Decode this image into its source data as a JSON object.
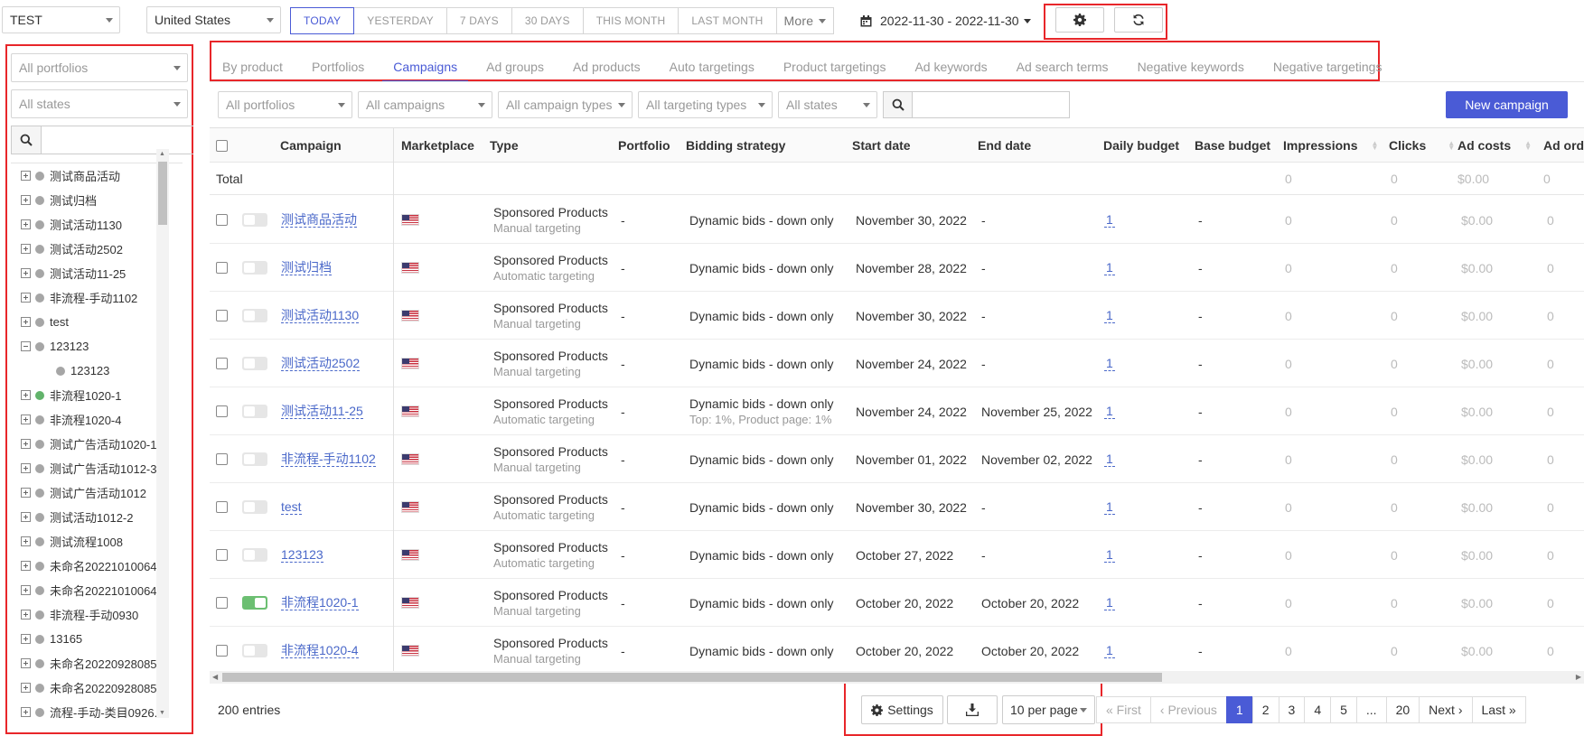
{
  "account_select": "TEST",
  "country_select": "United States",
  "date_buttons": [
    "TODAY",
    "YESTERDAY",
    "7 DAYS",
    "30 DAYS",
    "THIS MONTH",
    "LAST MONTH"
  ],
  "more_label": "More",
  "date_range": "2022-11-30 - 2022-11-30",
  "sidebar": {
    "portfolio_filter": "All portfolios",
    "state_filter": "All states",
    "tree": [
      {
        "label": "测试商品活动",
        "icon": "plus",
        "dot": "gray"
      },
      {
        "label": "测试归档",
        "icon": "plus",
        "dot": "gray"
      },
      {
        "label": "测试活动1130",
        "icon": "plus",
        "dot": "gray"
      },
      {
        "label": "测试活动2502",
        "icon": "plus",
        "dot": "gray"
      },
      {
        "label": "测试活动11-25",
        "icon": "plus",
        "dot": "gray"
      },
      {
        "label": "非流程-手动1102",
        "icon": "plus",
        "dot": "gray"
      },
      {
        "label": "test",
        "icon": "plus",
        "dot": "gray"
      },
      {
        "label": "123123",
        "icon": "minus",
        "dot": "gray"
      },
      {
        "label": "123123",
        "icon": "child",
        "dot": "gray"
      },
      {
        "label": "非流程1020-1",
        "icon": "plus",
        "dot": "green"
      },
      {
        "label": "非流程1020-4",
        "icon": "plus",
        "dot": "gray"
      },
      {
        "label": "测试广告活动1020-1",
        "icon": "plus",
        "dot": "gray"
      },
      {
        "label": "测试广告活动1012-3",
        "icon": "plus",
        "dot": "gray"
      },
      {
        "label": "测试广告活动1012",
        "icon": "plus",
        "dot": "gray"
      },
      {
        "label": "测试活动1012-2",
        "icon": "plus",
        "dot": "gray"
      },
      {
        "label": "测试流程1008",
        "icon": "plus",
        "dot": "gray"
      },
      {
        "label": "未命名20221010064...",
        "icon": "plus",
        "dot": "gray"
      },
      {
        "label": "未命名20221010064...",
        "icon": "plus",
        "dot": "gray"
      },
      {
        "label": "非流程-手动0930",
        "icon": "plus",
        "dot": "gray"
      },
      {
        "label": "13165",
        "icon": "plus",
        "dot": "gray"
      },
      {
        "label": "未命名20220928085...",
        "icon": "plus",
        "dot": "gray"
      },
      {
        "label": "未命名20220928085...",
        "icon": "plus",
        "dot": "gray"
      },
      {
        "label": "流程-手动-类目0926...",
        "icon": "plus",
        "dot": "gray"
      }
    ]
  },
  "tabs": [
    "By product",
    "Portfolios",
    "Campaigns",
    "Ad groups",
    "Ad products",
    "Auto targetings",
    "Product targetings",
    "Ad keywords",
    "Ad search terms",
    "Negative keywords",
    "Negative targetings"
  ],
  "active_tab": "Campaigns",
  "filters": [
    "All portfolios",
    "All campaigns",
    "All campaign types",
    "All targeting types",
    "All states"
  ],
  "new_campaign_label": "New campaign",
  "table": {
    "headers": [
      "Campaign",
      "Marketplace",
      "Type",
      "Portfolio",
      "Bidding strategy",
      "Start date",
      "End date",
      "Daily budget",
      "Base budget",
      "Impressions",
      "Clicks",
      "Ad costs",
      "Ad ord"
    ],
    "total_label": "Total",
    "totals": {
      "impressions": "0",
      "clicks": "0",
      "ad_costs": "$0.00",
      "ad_orders": "0"
    },
    "rows": [
      {
        "enabled": false,
        "campaign": "测试商品活动",
        "type": "Sponsored Products",
        "targeting": "Manual targeting",
        "portfolio": "-",
        "bidding": "Dynamic bids - down only",
        "bidding_sub": "",
        "start": "November 30, 2022",
        "end": "-",
        "daily_budget": "1",
        "base_budget": "-",
        "impressions": "0",
        "clicks": "0",
        "ad_costs": "$0.00",
        "ad_orders": "0"
      },
      {
        "enabled": false,
        "campaign": "测试归档",
        "type": "Sponsored Products",
        "targeting": "Automatic targeting",
        "portfolio": "-",
        "bidding": "Dynamic bids - down only",
        "bidding_sub": "",
        "start": "November 28, 2022",
        "end": "-",
        "daily_budget": "1",
        "base_budget": "-",
        "impressions": "0",
        "clicks": "0",
        "ad_costs": "$0.00",
        "ad_orders": "0"
      },
      {
        "enabled": false,
        "campaign": "测试活动1130",
        "type": "Sponsored Products",
        "targeting": "Manual targeting",
        "portfolio": "-",
        "bidding": "Dynamic bids - down only",
        "bidding_sub": "",
        "start": "November 30, 2022",
        "end": "-",
        "daily_budget": "1",
        "base_budget": "-",
        "impressions": "0",
        "clicks": "0",
        "ad_costs": "$0.00",
        "ad_orders": "0"
      },
      {
        "enabled": false,
        "campaign": "测试活动2502",
        "type": "Sponsored Products",
        "targeting": "Manual targeting",
        "portfolio": "-",
        "bidding": "Dynamic bids - down only",
        "bidding_sub": "",
        "start": "November 24, 2022",
        "end": "-",
        "daily_budget": "1",
        "base_budget": "-",
        "impressions": "0",
        "clicks": "0",
        "ad_costs": "$0.00",
        "ad_orders": "0"
      },
      {
        "enabled": false,
        "campaign": "测试活动11-25",
        "type": "Sponsored Products",
        "targeting": "Automatic targeting",
        "portfolio": "-",
        "bidding": "Dynamic bids - down only",
        "bidding_sub": "Top: 1%, Product page: 1%",
        "start": "November 24, 2022",
        "end": "November 25, 2022",
        "daily_budget": "1",
        "base_budget": "-",
        "impressions": "0",
        "clicks": "0",
        "ad_costs": "$0.00",
        "ad_orders": "0"
      },
      {
        "enabled": false,
        "campaign": "非流程-手动1102",
        "type": "Sponsored Products",
        "targeting": "Manual targeting",
        "portfolio": "-",
        "bidding": "Dynamic bids - down only",
        "bidding_sub": "",
        "start": "November 01, 2022",
        "end": "November 02, 2022",
        "daily_budget": "1",
        "base_budget": "-",
        "impressions": "0",
        "clicks": "0",
        "ad_costs": "$0.00",
        "ad_orders": "0"
      },
      {
        "enabled": false,
        "campaign": "test",
        "type": "Sponsored Products",
        "targeting": "Automatic targeting",
        "portfolio": "-",
        "bidding": "Dynamic bids - down only",
        "bidding_sub": "",
        "start": "November 30, 2022",
        "end": "-",
        "daily_budget": "1",
        "base_budget": "-",
        "impressions": "0",
        "clicks": "0",
        "ad_costs": "$0.00",
        "ad_orders": "0"
      },
      {
        "enabled": false,
        "campaign": "123123",
        "type": "Sponsored Products",
        "targeting": "Automatic targeting",
        "portfolio": "-",
        "bidding": "Dynamic bids - down only",
        "bidding_sub": "",
        "start": "October 27, 2022",
        "end": "-",
        "daily_budget": "1",
        "base_budget": "-",
        "impressions": "0",
        "clicks": "0",
        "ad_costs": "$0.00",
        "ad_orders": "0"
      },
      {
        "enabled": true,
        "campaign": "非流程1020-1",
        "type": "Sponsored Products",
        "targeting": "Manual targeting",
        "portfolio": "-",
        "bidding": "Dynamic bids - down only",
        "bidding_sub": "",
        "start": "October 20, 2022",
        "end": "October 20, 2022",
        "daily_budget": "1",
        "base_budget": "-",
        "impressions": "0",
        "clicks": "0",
        "ad_costs": "$0.00",
        "ad_orders": "0"
      },
      {
        "enabled": false,
        "campaign": "非流程1020-4",
        "type": "Sponsored Products",
        "targeting": "Manual targeting",
        "portfolio": "-",
        "bidding": "Dynamic bids - down only",
        "bidding_sub": "",
        "start": "October 20, 2022",
        "end": "October 20, 2022",
        "daily_budget": "1",
        "base_budget": "-",
        "impressions": "0",
        "clicks": "0",
        "ad_costs": "$0.00",
        "ad_orders": "0"
      }
    ]
  },
  "footer": {
    "entries": "200 entries",
    "settings_label": "Settings",
    "per_page": "10 per page",
    "pager": [
      "« First",
      "‹ Previous",
      "1",
      "2",
      "3",
      "4",
      "5",
      "...",
      "20",
      "Next ›",
      "Last »"
    ],
    "current_page": "1"
  },
  "colors": {
    "accent": "#4a5bd6",
    "link": "#4a68c9",
    "highlight_box": "#e8262a",
    "active_toggle": "#6cbf72"
  }
}
